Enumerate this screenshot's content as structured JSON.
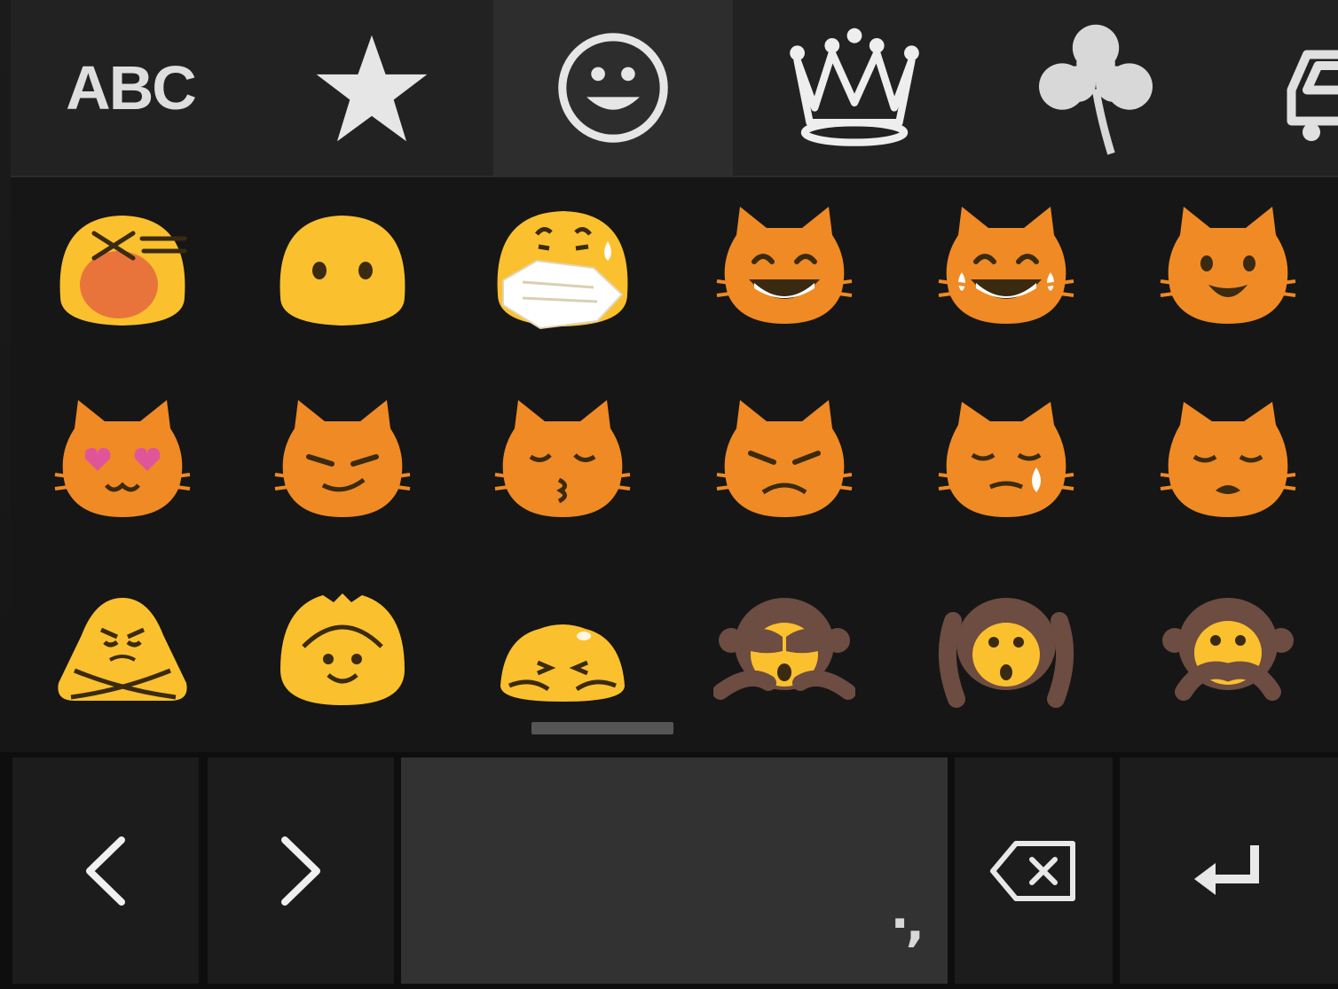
{
  "tabs": {
    "items": [
      {
        "id": "abc",
        "label": "ABC",
        "icon": "abc-text",
        "active": false
      },
      {
        "id": "recent",
        "icon": "star-icon",
        "active": false
      },
      {
        "id": "smileys",
        "icon": "smiley-icon",
        "active": true
      },
      {
        "id": "objects",
        "icon": "crown-icon",
        "active": false
      },
      {
        "id": "nature",
        "icon": "shamrock-icon",
        "active": false
      },
      {
        "id": "places",
        "icon": "car-icon",
        "active": false
      }
    ]
  },
  "emoji_grid": {
    "rows": [
      [
        "tired-face",
        "face-without-mouth",
        "face-with-medical-mask",
        "grinning-cat-face",
        "cat-face-tears-of-joy",
        "smiling-cat-face-open-mouth"
      ],
      [
        "heart-eyes-cat",
        "smirking-cat-face",
        "kissing-cat-face",
        "pouting-cat-face",
        "crying-cat-face",
        "weary-cat-face"
      ],
      [
        "no-good-gesture",
        "ok-gesture",
        "bowing-person",
        "see-no-evil-monkey",
        "hear-no-evil-monkey",
        "speak-no-evil-monkey"
      ]
    ]
  },
  "bottom_row": {
    "prev_icon": "chevron-left-icon",
    "next_icon": "chevron-right-icon",
    "space_hint": "·,",
    "backspace_icon": "backspace-icon",
    "enter_icon": "enter-icon"
  },
  "colors": {
    "emoji_yellow": "#FBC02D",
    "cat_orange": "#F08A24",
    "monkey_brown": "#6D4C41",
    "icon_light": "#E0E0E0",
    "active_tab": "#2D2D2D"
  }
}
